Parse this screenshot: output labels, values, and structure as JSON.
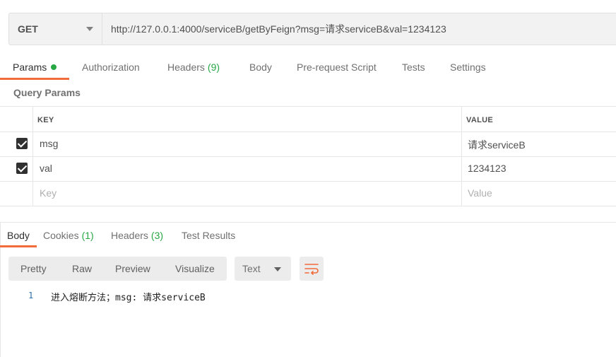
{
  "request": {
    "method": "GET",
    "url": "http://127.0.0.1:4000/serviceB/getByFeign?msg=请求serviceB&val=1234123"
  },
  "tabs": [
    {
      "label": "Params",
      "active": true,
      "has_dot": true
    },
    {
      "label": "Authorization"
    },
    {
      "label": "Headers",
      "count": "(9)"
    },
    {
      "label": "Body"
    },
    {
      "label": "Pre-request Script"
    },
    {
      "label": "Tests"
    },
    {
      "label": "Settings"
    }
  ],
  "query_params": {
    "title": "Query Params",
    "columns": {
      "key": "KEY",
      "value": "VALUE"
    },
    "rows": [
      {
        "checked": true,
        "key": "msg",
        "value": "请求serviceB"
      },
      {
        "checked": true,
        "key": "val",
        "value": "1234123"
      }
    ],
    "placeholder": {
      "key": "Key",
      "value": "Value"
    }
  },
  "response_tabs": [
    {
      "label": "Body",
      "active": true
    },
    {
      "label": "Cookies",
      "count": "(1)"
    },
    {
      "label": "Headers",
      "count": "(3)"
    },
    {
      "label": "Test Results"
    }
  ],
  "view_modes": [
    "Pretty",
    "Raw",
    "Preview",
    "Visualize"
  ],
  "format": "Text",
  "response_body": {
    "line_number": "1",
    "text": "进入熔断方法；msg: 请求serviceB"
  },
  "colors": {
    "accent": "#f26b3a",
    "count_green": "#28a745",
    "icon_wrap": "#f26b3a"
  },
  "icons": {
    "method_dropdown": "chevron-down-icon",
    "wrap": "wrap-lines-icon"
  }
}
